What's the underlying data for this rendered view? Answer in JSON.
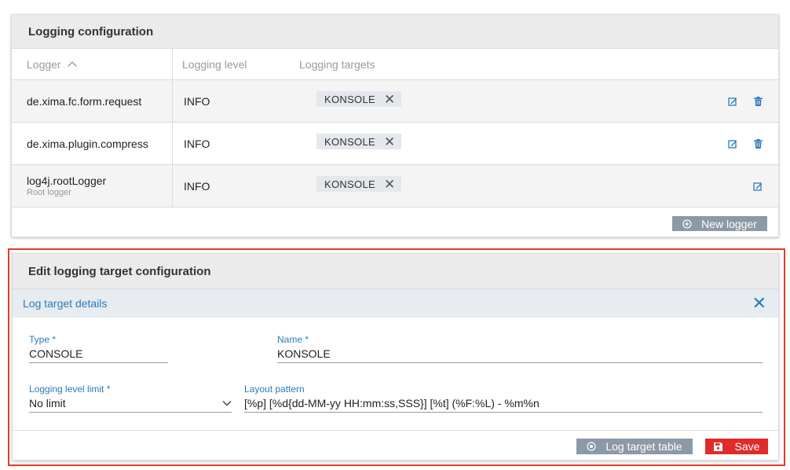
{
  "logging_config": {
    "title": "Logging configuration",
    "columns": {
      "logger": "Logger",
      "level": "Logging level",
      "targets": "Logging targets"
    },
    "rows": [
      {
        "logger": "de.xima.fc.form.request",
        "sub": "",
        "level": "INFO",
        "target": "KONSOLE"
      },
      {
        "logger": "de.xima.plugin.compress",
        "sub": "",
        "level": "INFO",
        "target": "KONSOLE"
      },
      {
        "logger": "log4j.rootLogger",
        "sub": "Root logger",
        "level": "INFO",
        "target": "KONSOLE"
      }
    ],
    "new_logger_label": "New logger"
  },
  "edit_target": {
    "title": "Edit logging target configuration",
    "subheader": "Log target details",
    "type": {
      "label": "Type *",
      "value": "CONSOLE"
    },
    "name": {
      "label": "Name *",
      "value": "KONSOLE"
    },
    "level_limit": {
      "label": "Logging level limit *",
      "value": "No limit"
    },
    "layout_pattern": {
      "label": "Layout pattern",
      "value": "[%p] [%d{dd-MM-yy HH:mm:ss,SSS}] [%t] (%F:%L) - %m%n"
    },
    "log_target_table_label": "Log target table",
    "save_label": "Save"
  },
  "colors": {
    "accent": "#2a7bbf",
    "save": "#e02b2b",
    "highlight": "#e53a23",
    "secondary_button": "#8c99a6"
  }
}
